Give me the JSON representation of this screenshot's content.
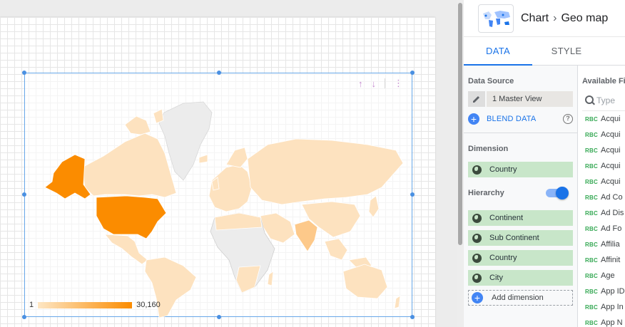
{
  "header": {
    "breadcrumb_parent": "Chart",
    "breadcrumb_current": "Geo map",
    "thumbnail_icon": "world-map-icon"
  },
  "tabs": [
    {
      "label": "DATA",
      "active": true
    },
    {
      "label": "STYLE",
      "active": false
    }
  ],
  "data_source": {
    "title": "Data Source",
    "name": "1 Master View",
    "blend_label": "BLEND DATA",
    "help_icon": "?"
  },
  "dimension": {
    "title": "Dimension",
    "value": "Country"
  },
  "hierarchy": {
    "title": "Hierarchy",
    "enabled": true,
    "items": [
      "Continent",
      "Sub Continent",
      "Country",
      "City"
    ],
    "add_label": "Add dimension"
  },
  "available_fields": {
    "title": "Available Fie",
    "search_placeholder": "Type",
    "type_badge": "RBC",
    "items": [
      "Acqui",
      "Acqui",
      "Acqui",
      "Acqui",
      "Acqui",
      "Ad Co",
      "Ad Dis",
      "Ad Fo",
      "Affilia",
      "Affinit",
      "Age",
      "App ID",
      "App In",
      "App N"
    ]
  },
  "chart": {
    "legend_min": "1",
    "legend_max": "30,160",
    "color_low": "#fde6c4",
    "color_high": "#fb8c00",
    "no_data_color": "#eeeeee"
  },
  "chart_data": {
    "type": "geo",
    "metric_range": [
      1,
      30160
    ],
    "regions": [
      {
        "region": "United States",
        "intensity": 1.0
      },
      {
        "region": "Alaska",
        "intensity": 1.0
      },
      {
        "region": "India",
        "intensity": 0.35
      },
      {
        "region": "Canada",
        "intensity": 0.12
      },
      {
        "region": "Greenland",
        "intensity": null
      }
    ]
  }
}
